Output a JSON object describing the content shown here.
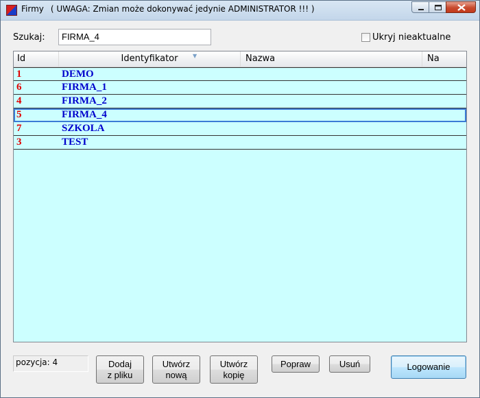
{
  "window": {
    "title": "Firmy",
    "title_note": "( UWAGA: Zmian może dokonywać jedynie ADMINISTRATOR !!! )"
  },
  "search": {
    "label": "Szukaj:",
    "value": "FIRMA_4"
  },
  "filter": {
    "hide_outdated_label": "Ukryj nieaktualne",
    "hide_outdated_checked": false
  },
  "grid": {
    "columns": [
      "Id",
      "Identyfikator",
      "Nazwa",
      "Na"
    ],
    "sorted_column": "Identyfikator",
    "rows": [
      {
        "id": "1",
        "identyfikator": "DEMO",
        "nazwa": ""
      },
      {
        "id": "6",
        "identyfikator": "FIRMA_1",
        "nazwa": ""
      },
      {
        "id": "4",
        "identyfikator": "FIRMA_2",
        "nazwa": ""
      },
      {
        "id": "5",
        "identyfikator": "FIRMA_4",
        "nazwa": ""
      },
      {
        "id": "7",
        "identyfikator": "SZKOLA",
        "nazwa": ""
      },
      {
        "id": "3",
        "identyfikator": "TEST",
        "nazwa": ""
      }
    ],
    "selected_index": 3,
    "colors": {
      "background": "#ccffff",
      "id_text": "#e00000",
      "name_text": "#0000cc"
    }
  },
  "status": {
    "position_text": "pozycja:  4"
  },
  "buttons": {
    "add_from_file": [
      "Dodaj",
      "z pliku"
    ],
    "create_new": [
      "Utwórz",
      "nową"
    ],
    "create_copy": [
      "Utwórz",
      "kopię"
    ],
    "edit": "Popraw",
    "delete": "Usuń",
    "login": "Logowanie"
  },
  "titlebar_icons": [
    "app-icon",
    "minimize-icon",
    "maximize-icon",
    "close-icon"
  ]
}
